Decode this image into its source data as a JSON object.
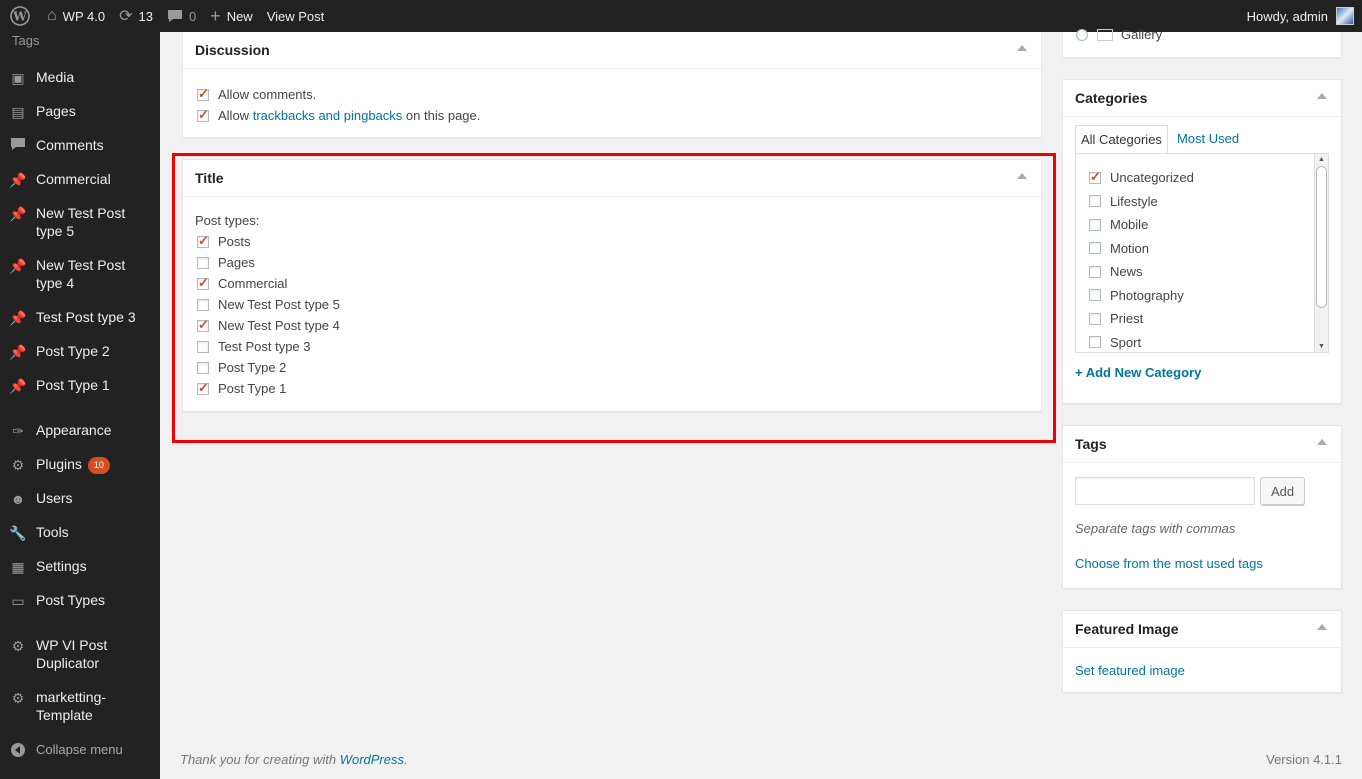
{
  "adminbar": {
    "site_name": "WP 4.0",
    "updates_count": "13",
    "comments_count": "0",
    "new_label": "New",
    "view_post_label": "View Post",
    "howdy": "Howdy, admin"
  },
  "sidebar": {
    "tags_label": "Tags",
    "items": [
      {
        "label": "Media",
        "icon": "media-icon"
      },
      {
        "label": "Pages",
        "icon": "pages-icon"
      },
      {
        "label": "Comments",
        "icon": "comments-icon"
      },
      {
        "label": "Commercial",
        "icon": "pin-icon"
      },
      {
        "label": "New Test Post type 5",
        "icon": "pin-icon"
      },
      {
        "label": "New Test Post type 4",
        "icon": "pin-icon"
      },
      {
        "label": "Test Post type 3",
        "icon": "pin-icon"
      },
      {
        "label": "Post Type 2",
        "icon": "pin-icon"
      },
      {
        "label": "Post Type 1",
        "icon": "pin-icon"
      },
      {
        "label": "Appearance",
        "icon": "brush-icon"
      },
      {
        "label": "Plugins",
        "icon": "plugin-icon",
        "badge": "10"
      },
      {
        "label": "Users",
        "icon": "users-icon"
      },
      {
        "label": "Tools",
        "icon": "wrench-icon"
      },
      {
        "label": "Settings",
        "icon": "settings-icon"
      },
      {
        "label": "Post Types",
        "icon": "post-types-icon"
      },
      {
        "label": "WP VI Post Duplicator",
        "icon": "gear-icon"
      },
      {
        "label": "marketting-Template",
        "icon": "gear-icon"
      }
    ],
    "collapse_label": "Collapse menu"
  },
  "discussion": {
    "title": "Discussion",
    "allow_comments": "Allow comments.",
    "allow_prefix": "Allow",
    "trackbacks_link": "trackbacks and pingbacks",
    "allow_suffix": "on this page."
  },
  "title_box": {
    "title": "Title",
    "post_types_label": "Post types:",
    "post_types": [
      {
        "label": "Posts",
        "checked": true
      },
      {
        "label": "Pages",
        "checked": false
      },
      {
        "label": "Commercial",
        "checked": true
      },
      {
        "label": "New Test Post type 5",
        "checked": false
      },
      {
        "label": "New Test Post type 4",
        "checked": true
      },
      {
        "label": "Test Post type 3",
        "checked": false
      },
      {
        "label": "Post Type 2",
        "checked": false
      },
      {
        "label": "Post Type 1",
        "checked": true
      }
    ]
  },
  "gallery_label": "Gallery",
  "categories": {
    "title": "Categories",
    "tab_all": "All Categories",
    "tab_most_used": "Most Used",
    "items": [
      {
        "label": "Uncategorized",
        "checked": true
      },
      {
        "label": "Lifestyle",
        "checked": false
      },
      {
        "label": "Mobile",
        "checked": false
      },
      {
        "label": "Motion",
        "checked": false
      },
      {
        "label": "News",
        "checked": false
      },
      {
        "label": "Photography",
        "checked": false
      },
      {
        "label": "Priest",
        "checked": false
      },
      {
        "label": "Sport",
        "checked": false
      }
    ],
    "add_new": "+ Add New Category"
  },
  "tags": {
    "title": "Tags",
    "input_value": "",
    "add_button": "Add",
    "hint": "Separate tags with commas",
    "choose_link": "Choose from the most used tags"
  },
  "featured_image": {
    "title": "Featured Image",
    "set_link": "Set featured image"
  },
  "footer": {
    "thanks_prefix": "Thank you for creating with",
    "wordpress_link": "WordPress",
    "thanks_suffix": ".",
    "version": "Version 4.1.1"
  },
  "colors": {
    "admin_bar": "#222222",
    "link": "#0074a2",
    "checkmark": "#d54e21",
    "highlight": "#e00000"
  }
}
